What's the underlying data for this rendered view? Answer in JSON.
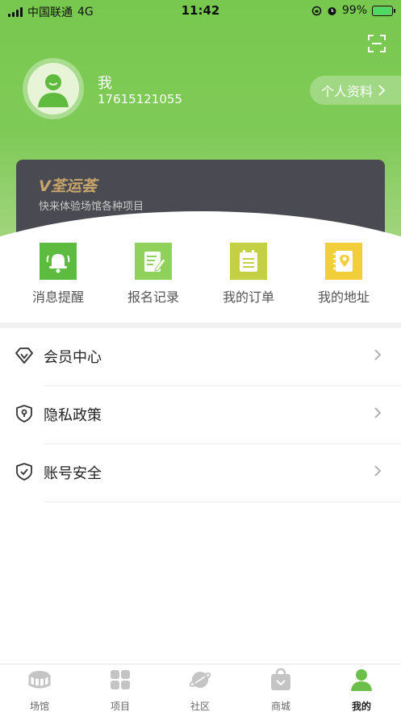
{
  "status_bar": {
    "carrier": "中国联通",
    "network": "4G",
    "time": "11:42",
    "battery": "99%"
  },
  "profile": {
    "name": "我",
    "phone": "17615121055",
    "profile_button": "个人资料"
  },
  "banner": {
    "logo": "V荃运荟",
    "subtitle": "快来体验场馆各种项目"
  },
  "quick_actions": [
    {
      "label": "消息提醒",
      "icon": "bell-icon",
      "color": "#5dbb3f"
    },
    {
      "label": "报名记录",
      "icon": "edit-note-icon",
      "color": "#8fd15a"
    },
    {
      "label": "我的订单",
      "icon": "order-icon",
      "color": "#c4cf43"
    },
    {
      "label": "我的地址",
      "icon": "address-icon",
      "color": "#f2cf3a"
    }
  ],
  "menu": [
    {
      "label": "会员中心",
      "icon": "diamond-icon"
    },
    {
      "label": "隐私政策",
      "icon": "shield-location-icon"
    },
    {
      "label": "账号安全",
      "icon": "shield-check-icon"
    }
  ],
  "tabbar": [
    {
      "label": "场馆",
      "icon": "stadium-icon",
      "active": false
    },
    {
      "label": "项目",
      "icon": "grid-icon",
      "active": false
    },
    {
      "label": "社区",
      "icon": "planet-icon",
      "active": false
    },
    {
      "label": "商城",
      "icon": "shopping-bag-icon",
      "active": false
    },
    {
      "label": "我的",
      "icon": "person-icon",
      "active": true
    }
  ],
  "colors": {
    "brand_green": "#78c84f",
    "banner_bg": "#4a4b52",
    "banner_gold": "#c8a56a",
    "active_tab": "#6cbf4a",
    "inactive_tab": "#c4c4c4"
  }
}
